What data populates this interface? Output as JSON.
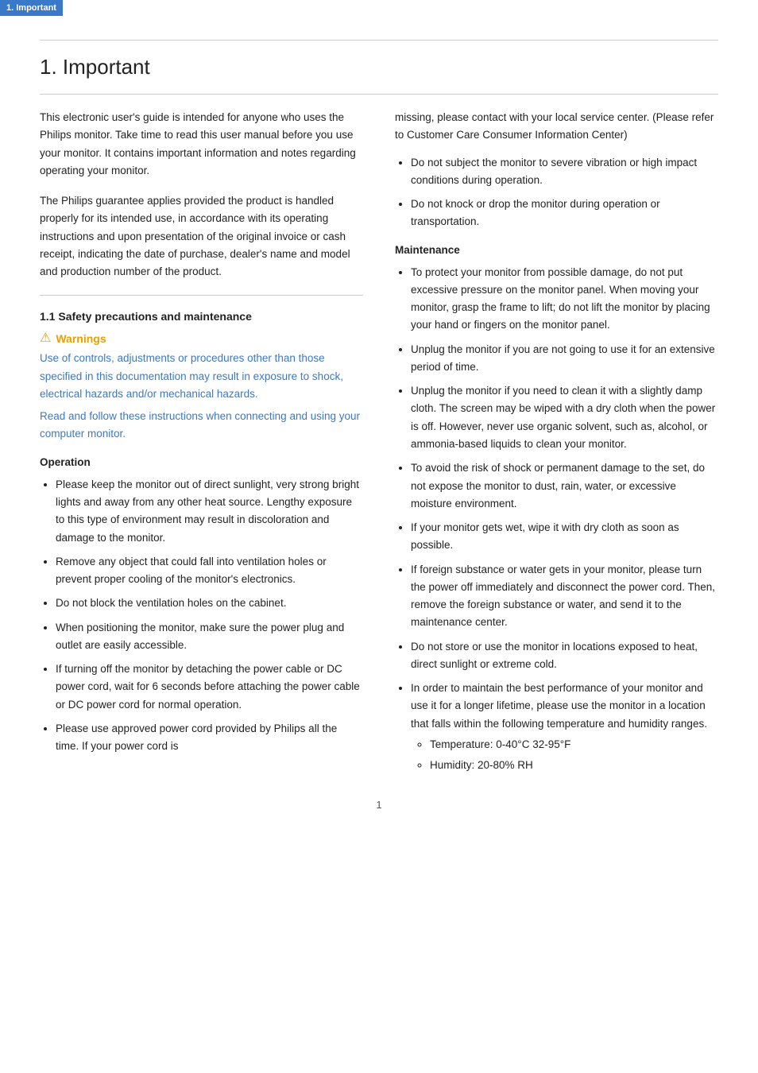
{
  "tab": {
    "label": "1. Important"
  },
  "page": {
    "title": "1.  Important",
    "intro1": "This electronic user's guide is intended for anyone who uses the Philips monitor. Take time to read this user manual before you use your monitor. It contains important information and notes regarding operating your monitor.",
    "intro2": "The Philips guarantee applies provided the product is handled properly for its intended use, in accordance with its operating instructions and upon presentation of the original invoice or cash receipt, indicating the date of purchase, dealer's name and model and production number of the product.",
    "safety_section_title": "1.1 Safety precautions and maintenance",
    "warnings_label": "Warnings",
    "warnings_text1": "Use of controls, adjustments or procedures other than those specified in this documentation may result in exposure to shock, electrical hazards and/or mechanical hazards.",
    "warnings_text2": "Read and follow these instructions when connecting and using your computer monitor.",
    "operation_title": "Operation",
    "operation_items": [
      "Please keep the monitor out of direct sunlight, very strong bright lights and away from any other heat source. Lengthy exposure to this type of environment may result in discoloration and damage to the monitor.",
      "Remove any object that could fall into ventilation holes or prevent proper cooling of the monitor's electronics.",
      "Do not block the ventilation holes on the cabinet.",
      "When positioning the monitor, make sure the power plug and outlet are easily accessible.",
      "If turning off the monitor by detaching the power cable or DC power cord, wait for 6 seconds before attaching the power cable or DC power cord for normal operation.",
      "Please use approved power cord provided by Philips all the time. If your power cord is"
    ],
    "right_col": {
      "power_cord_continued": "missing, please contact with your local service center. (Please refer to Customer Care Consumer Information Center)",
      "operation_items_right": [
        "Do not subject the monitor to severe vibration or high impact conditions during operation.",
        "Do not knock or drop the monitor during operation or transportation."
      ],
      "maintenance_title": "Maintenance",
      "maintenance_items": [
        "To protect your monitor from possible damage, do not put excessive pressure on the monitor panel. When moving your monitor, grasp the frame to lift; do not lift the monitor by placing your hand or fingers on the monitor panel.",
        "Unplug the monitor if you are not going to use it for an extensive period of time.",
        "Unplug the monitor if you need to clean it with a slightly damp cloth. The screen may be wiped with a dry cloth when the power is off. However, never use organic solvent, such as, alcohol, or ammonia-based liquids to clean your monitor.",
        "To avoid the risk of shock or permanent damage to the set, do not expose the monitor to dust, rain, water, or excessive moisture environment.",
        "If your monitor gets wet, wipe it with dry cloth as soon as possible.",
        "If foreign substance or water gets in your monitor, please turn the power off immediately and disconnect the power cord. Then, remove the foreign substance or water, and send it to the maintenance center.",
        "Do not store or use the monitor in locations exposed to heat, direct sunlight or extreme cold.",
        "In order to maintain the best performance of your monitor and use it for a longer lifetime, please use the monitor in a location that falls within the following temperature and humidity ranges."
      ],
      "temp_humidity": [
        "Temperature: 0-40°C  32-95°F",
        "Humidity: 20-80% RH"
      ]
    },
    "page_number": "1"
  }
}
